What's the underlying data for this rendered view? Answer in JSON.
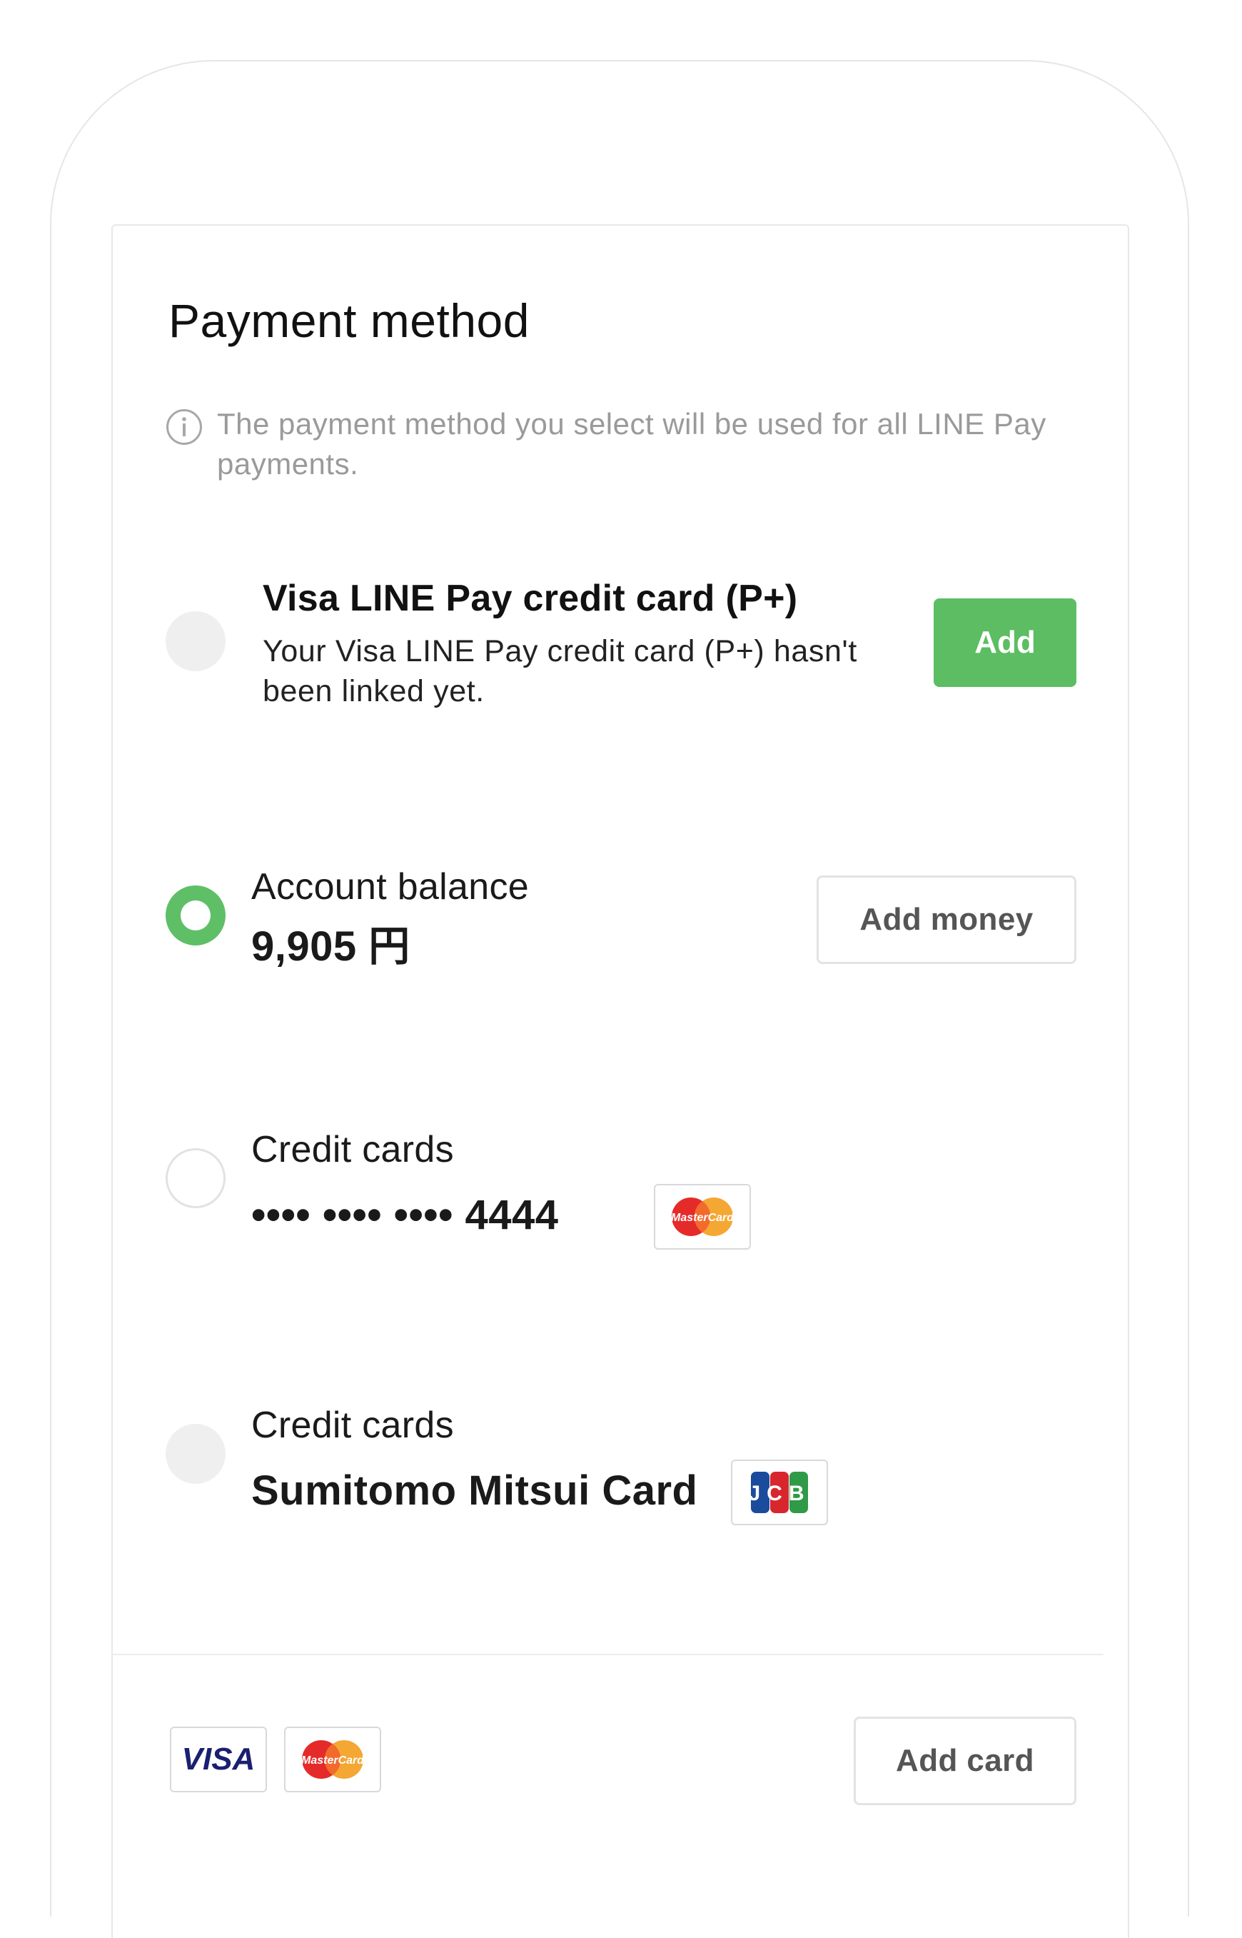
{
  "header": {
    "title": "Payment method"
  },
  "notice": {
    "icon": "info-icon",
    "text": "The payment method you select will be used for all LINE Pay payments."
  },
  "options": [
    {
      "state": "disabled",
      "title": "Visa LINE Pay credit card (P+)",
      "description": "Your Visa LINE Pay credit card (P+) hasn't been linked yet.",
      "action_label": "Add"
    },
    {
      "state": "selected",
      "label": "Account balance",
      "value": "9,905 円",
      "action_label": "Add money"
    },
    {
      "state": "unselected",
      "label": "Credit cards",
      "value": "•••• •••• •••• 4444",
      "brand": "mastercard",
      "brand_text": "MasterCard"
    },
    {
      "state": "disabled",
      "label": "Credit cards",
      "value": "Sumitomo Mitsui Card",
      "brand": "jcb",
      "brand_text": "JCB"
    }
  ],
  "footer": {
    "accepted_brands": [
      {
        "name": "visa",
        "text": "VISA"
      },
      {
        "name": "mastercard",
        "text": "MasterCard"
      }
    ],
    "add_card_label": "Add card"
  },
  "colors": {
    "accent_green": "#5cbd63",
    "muted_text": "#9a9a9a",
    "border": "#e3e3e3",
    "mastercard_red": "#e52a2a",
    "mastercard_orange": "#f4a732",
    "jcb_blue": "#1b4b9c",
    "jcb_red": "#d8262f",
    "jcb_green": "#2f9a47",
    "visa_blue": "#1a1f71"
  }
}
